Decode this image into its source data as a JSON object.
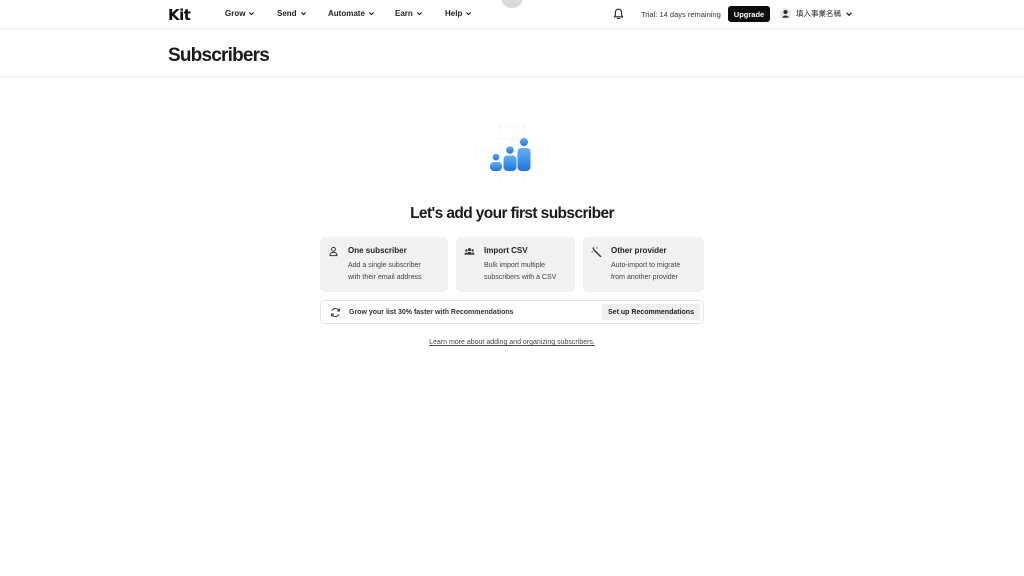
{
  "brand": {
    "logo": "Kit"
  },
  "nav": {
    "items": [
      {
        "label": "Grow"
      },
      {
        "label": "Send"
      },
      {
        "label": "Automate"
      },
      {
        "label": "Earn"
      },
      {
        "label": "Help"
      }
    ]
  },
  "header_right": {
    "trial_text": "Trial: 14 days remaining",
    "upgrade_label": "Upgrade",
    "account_name": "填入事業名稱"
  },
  "page": {
    "title": "Subscribers"
  },
  "empty_state": {
    "title": "Let's add your first subscriber",
    "options": [
      {
        "icon": "person-icon",
        "title": "One subscriber",
        "description": "Add a single subscriber with their email address"
      },
      {
        "icon": "people-icon",
        "title": "Import CSV",
        "description": "Bulk import multiple subscribers with a CSV"
      },
      {
        "icon": "magic-wand-icon",
        "title": "Other provider",
        "description": "Auto-import to migrate from another provider"
      }
    ],
    "recommendations": {
      "icon": "refresh-icon",
      "text": "Grow your list 30% faster with Recommendations",
      "button_label": "Set up Recommendations"
    },
    "learn_more": "Learn more about adding and organizing subscribers."
  },
  "colors": {
    "accent_blue": "#2f8be8",
    "upgrade_bg": "#0c0c0c",
    "card_bg": "#f1f1f1"
  }
}
